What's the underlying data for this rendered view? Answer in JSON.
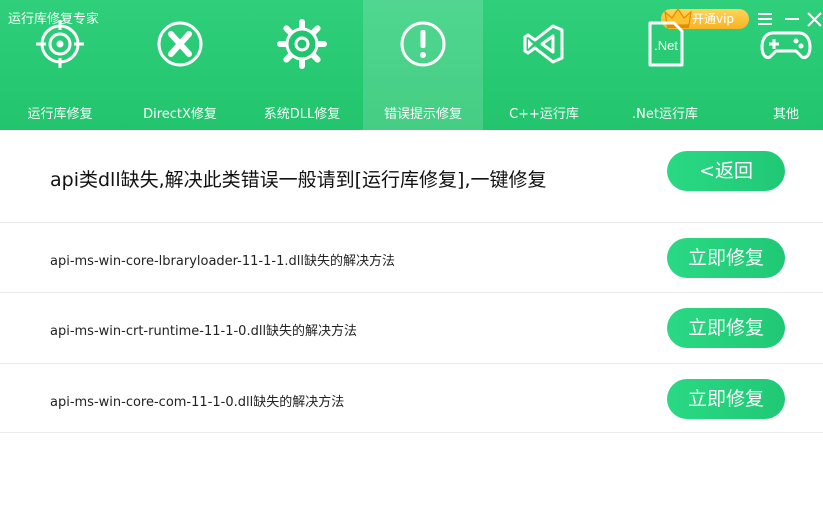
{
  "app": {
    "title": "运行库修复专家"
  },
  "titlebar": {
    "vip_label": "开通vip"
  },
  "nav": [
    {
      "label": "运行库修复",
      "icon": "crosshair-icon"
    },
    {
      "label": "DirectX修复",
      "icon": "directx-icon"
    },
    {
      "label": "系统DLL修复",
      "icon": "gear-icon"
    },
    {
      "label": "错误提示修复",
      "icon": "exclamation-icon",
      "active": true
    },
    {
      "label": "C++运行库",
      "icon": "visual-studio-icon"
    },
    {
      "label": ".Net运行库",
      "icon": "dotnet-icon",
      "icon_text": ".Net"
    },
    {
      "label": "其他",
      "icon": "gamepad-icon"
    }
  ],
  "main": {
    "title": "api类dll缺失,解决此类错误一般请到[运行库修复],一键修复",
    "back_label": "<返回",
    "items": [
      {
        "text": "api-ms-win-core-lbraryloader-11-1-1.dll缺失的解决方法",
        "action": "立即修复"
      },
      {
        "text": "api-ms-win-crt-runtime-11-1-0.dll缺失的解决方法",
        "action": "立即修复"
      },
      {
        "text": "api-ms-win-core-com-11-1-0.dll缺失的解决方法",
        "action": "立即修复"
      }
    ]
  },
  "colors": {
    "header_green": "#22c46d",
    "button_green": "#20c874",
    "vip_gold": "#f7b324"
  }
}
